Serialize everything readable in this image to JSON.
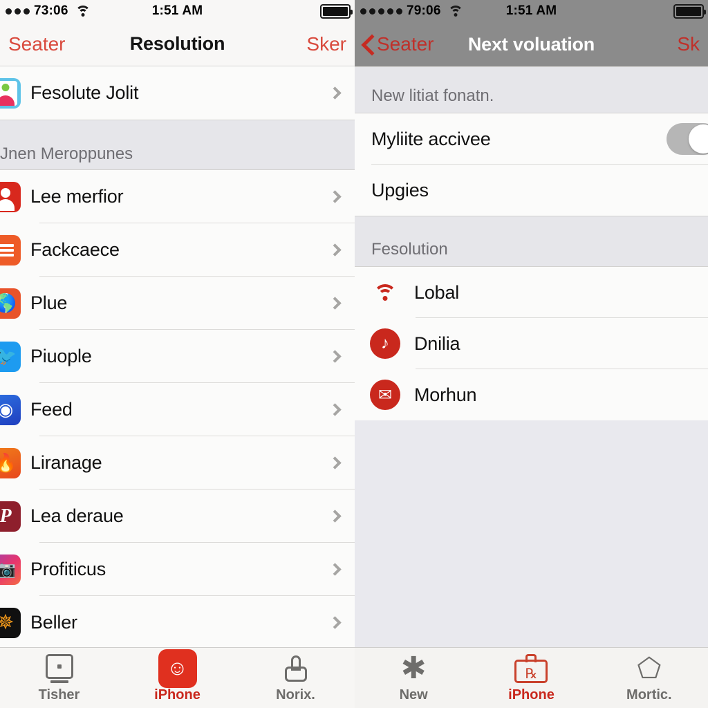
{
  "left_panel": {
    "status_bar": {
      "signal_dots": 3,
      "carrier": "73:06",
      "wifi_icon": "wifi-icon",
      "time": "1:51 AM",
      "battery_icon": "battery-full-icon"
    },
    "nav": {
      "back_label": "Seater",
      "title": "Resolution",
      "action_label": "Sker"
    },
    "top_row": {
      "label": "Fesolute Jolit",
      "icon": "contact-card-icon"
    },
    "section_header": "Jnen Meroppunes",
    "rows": [
      {
        "label": "Lee merfior",
        "icon": "person-icon"
      },
      {
        "label": "Fackcaece",
        "icon": "lines-icon"
      },
      {
        "label": "Plue",
        "icon": "globe-icon"
      },
      {
        "label": "Piuople",
        "icon": "bird-icon"
      },
      {
        "label": "Feed",
        "icon": "compass-icon"
      },
      {
        "label": "Liranage",
        "icon": "flame-icon"
      },
      {
        "label": "Lea deraue",
        "icon": "pin-icon"
      },
      {
        "label": "Profiticus",
        "icon": "camera-icon"
      },
      {
        "label": "Beller",
        "icon": "burst-icon"
      }
    ],
    "tabs": [
      {
        "label": "Tisher",
        "icon": "monitor-icon",
        "selected": false
      },
      {
        "label": "iPhone",
        "icon": "person-badge-icon",
        "selected": true
      },
      {
        "label": "Norix.",
        "icon": "mouse-icon",
        "selected": false
      }
    ]
  },
  "right_panel": {
    "status_bar": {
      "signal_dots": 5,
      "carrier": "79:06",
      "wifi_icon": "wifi-icon",
      "time": "1:51 AM",
      "battery_icon": "battery-full-icon"
    },
    "nav": {
      "back_chevron_icon": "chevron-left-icon",
      "back_label": "Seater",
      "title": "Next voluation",
      "action_label": "Sk"
    },
    "section_one_header": "New litiat fonatn.",
    "section_one_rows": [
      {
        "label": "Myliite accivee",
        "control": "toggle",
        "toggle_on": false
      },
      {
        "label": "Upgies",
        "control": "none"
      }
    ],
    "section_two_header": "Fesolution",
    "section_two_rows": [
      {
        "label": "Lobal",
        "icon": "wifi-icon"
      },
      {
        "label": "Dnilia",
        "icon": "music-note-icon"
      },
      {
        "label": "Morhun",
        "icon": "envelope-icon"
      }
    ],
    "tabs": [
      {
        "label": "New",
        "icon": "star-icon",
        "selected": false
      },
      {
        "label": "iPhone",
        "icon": "briefcase-icon",
        "selected": true
      },
      {
        "label": "Mortic.",
        "icon": "shield-icon",
        "selected": false
      }
    ]
  },
  "colors": {
    "accent_red": "#c9281d",
    "nav_red": "#d94a3d",
    "dimmed_header": "#8b8b8b",
    "list_bg": "#fbfbfa",
    "section_bg": "#e6e6ea"
  }
}
